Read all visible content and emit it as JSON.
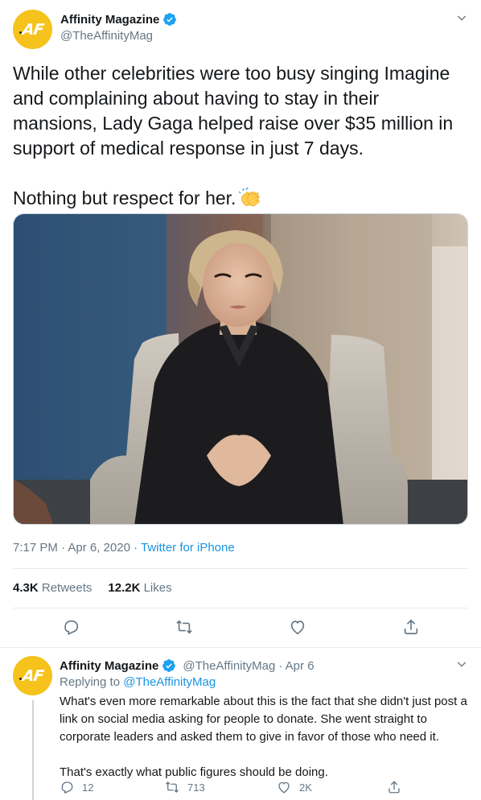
{
  "tweet": {
    "author_name": "Affinity Magazine",
    "author_handle": "@TheAffinityMag",
    "avatar_text": "AF",
    "text_p1": "While other celebrities were too busy singing Imagine and complaining about having to stay in their mansions, Lady Gaga helped raise over $35 million in support of medical response in just 7 days.",
    "text_p2": "Nothing but respect for her.",
    "emoji": "clapping-hands",
    "timestamp": "7:17 PM · Apr 6, 2020 · ",
    "source": "Twitter for iPhone",
    "retweets_count": "4.3K",
    "retweets_label": "Retweets",
    "likes_count": "12.2K",
    "likes_label": "Likes"
  },
  "reply": {
    "author_name": "Affinity Magazine",
    "author_handle": "@TheAffinityMag",
    "date": "· Apr 6",
    "avatar_text": "AF",
    "replying_prefix": "Replying to ",
    "replying_to": "@TheAffinityMag",
    "text_p1": "What's even more remarkable about this is the fact that she didn't just post a link on social media asking for people to donate. She went straight to corporate leaders and asked them to give in favor of those who need it.",
    "text_p2": "That's exactly what public figures should be doing.",
    "reply_count": "12",
    "retweet_count": "713",
    "like_count": "2K"
  },
  "colors": {
    "accent": "#1b95e0",
    "avatar": "#f6c21c",
    "muted": "#657786",
    "text": "#14171a"
  },
  "icons": [
    "verified-badge-icon",
    "chevron-down-icon",
    "reply-icon",
    "retweet-icon",
    "like-icon",
    "share-icon"
  ]
}
